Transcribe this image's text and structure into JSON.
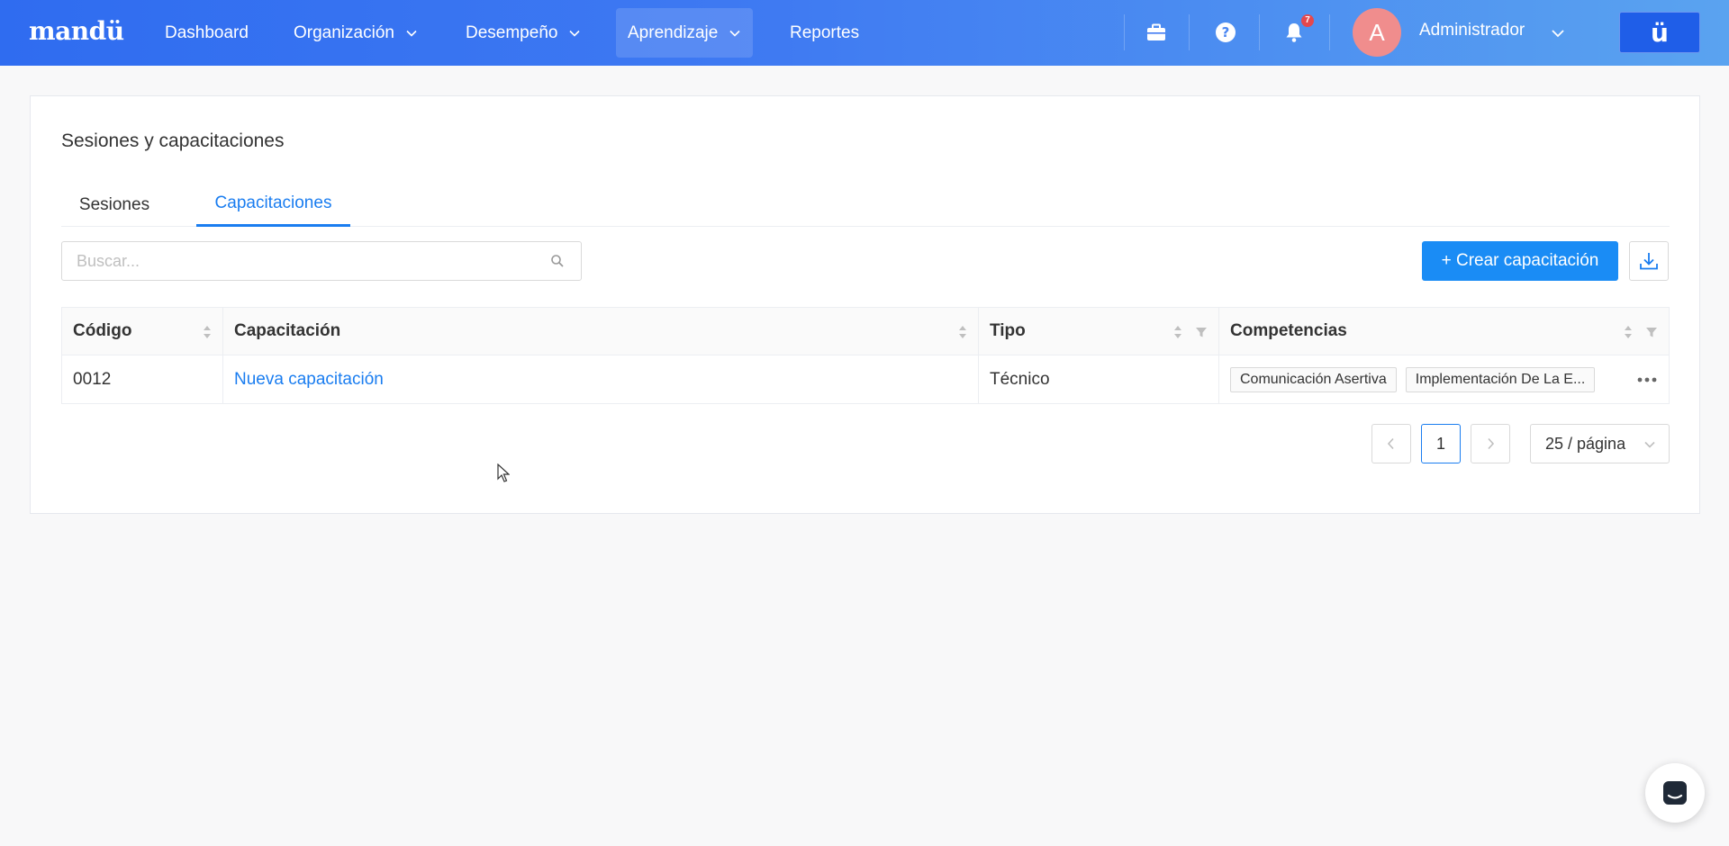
{
  "app": {
    "logo": "mandü",
    "brand_button": "ü"
  },
  "nav": {
    "items": [
      {
        "label": "Dashboard"
      },
      {
        "label": "Organización"
      },
      {
        "label": "Desempeño"
      },
      {
        "label": "Aprendizaje"
      },
      {
        "label": "Reportes"
      }
    ],
    "active": "Aprendizaje"
  },
  "header": {
    "notifications_count": "7",
    "user_initial": "A",
    "user_name": "Administrador",
    "icons": [
      "briefcase-icon",
      "help-icon",
      "bell-icon"
    ]
  },
  "page": {
    "title": "Sesiones y capacitaciones",
    "tabs": [
      {
        "label": "Sesiones"
      },
      {
        "label": "Capacitaciones"
      }
    ],
    "active_tab": "Capacitaciones"
  },
  "toolbar": {
    "search_placeholder": "Buscar...",
    "create_label": "+ Crear capacitación"
  },
  "table": {
    "columns": [
      "Código",
      "Capacitación",
      "Tipo",
      "Competencias"
    ],
    "rows": [
      {
        "codigo": "0012",
        "capacitacion": "Nueva capacitación",
        "tipo": "Técnico",
        "competencias": [
          "Comunicación Asertiva",
          "Implementación De La E..."
        ]
      }
    ]
  },
  "pagination": {
    "current_page": "1",
    "page_size": "25 / página"
  },
  "colors": {
    "accent": "#1a7df0",
    "primary_button": "#1a8cf5",
    "topbar_start": "#2f6cf0",
    "topbar_end": "#5aa3f0",
    "badge": "#e5484d"
  }
}
